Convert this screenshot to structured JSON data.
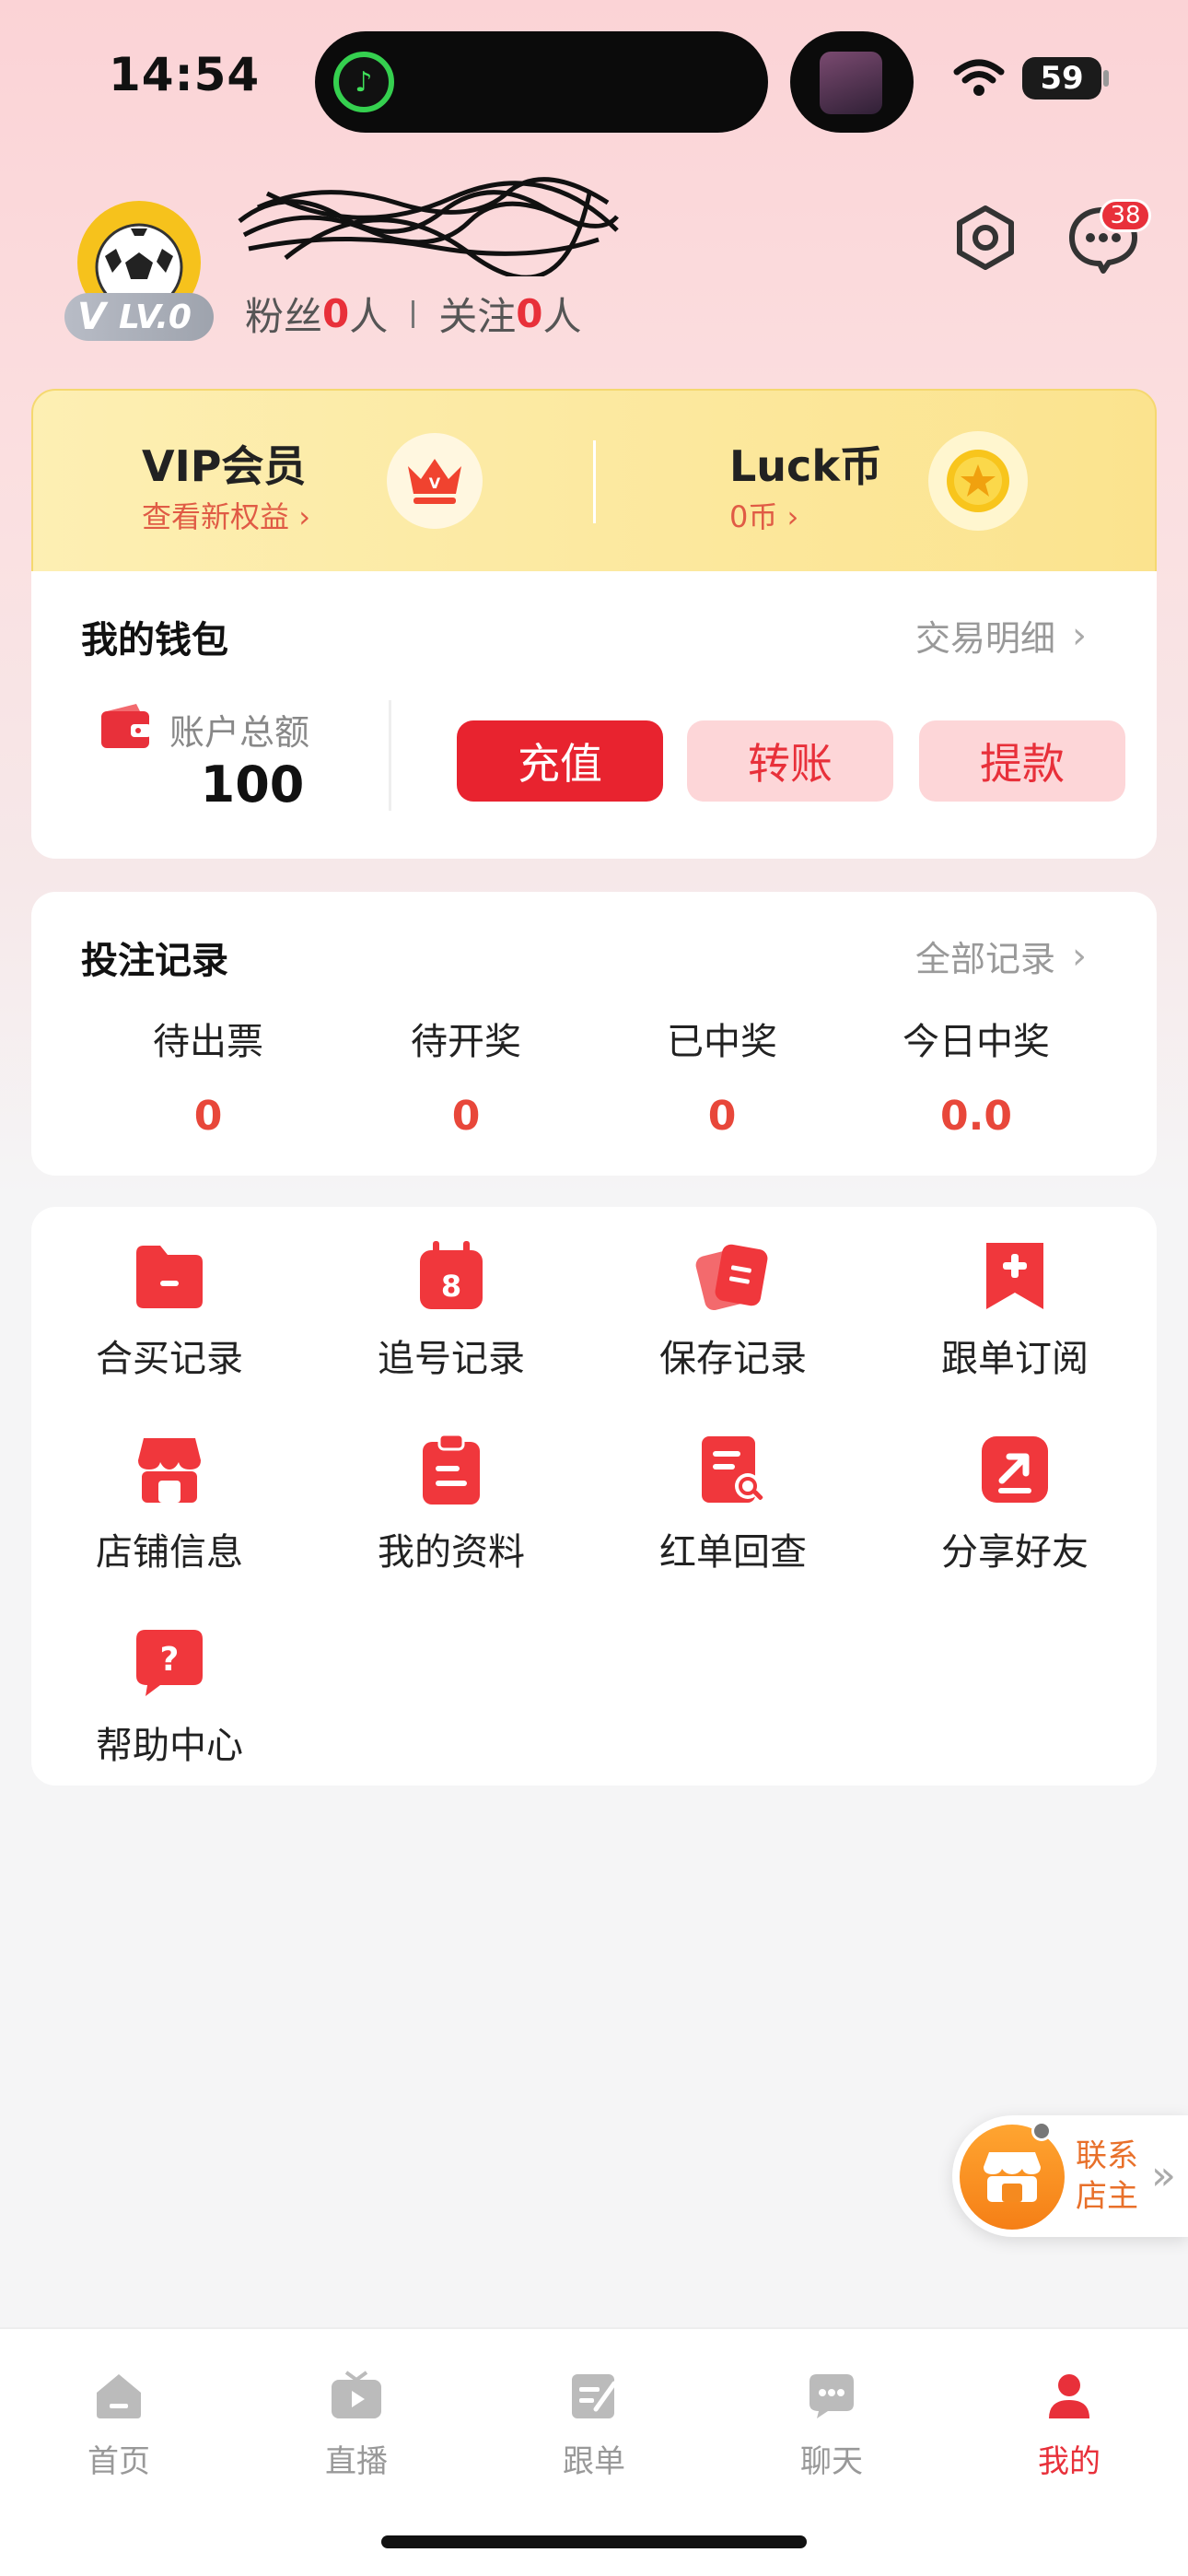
{
  "status_bar": {
    "time": "14:54",
    "battery": "59"
  },
  "profile": {
    "level": "LV.0",
    "level_v": "V",
    "fans_label": "粉丝",
    "fans_count": "0",
    "fans_unit": "人",
    "follow_label": "关注",
    "follow_count": "0",
    "follow_unit": "人",
    "message_badge": "38"
  },
  "vip": {
    "title": "VIP会员",
    "subtitle": "查看新权益",
    "luck_title": "Luck币",
    "luck_sub": "0币"
  },
  "wallet": {
    "title": "我的钱包",
    "link": "交易明细",
    "balance_label": "账户总额",
    "balance_value": "100",
    "buttons": [
      "充值",
      "转账",
      "提款"
    ]
  },
  "bets": {
    "title": "投注记录",
    "link": "全部记录",
    "stats": [
      {
        "label": "待出票",
        "value": "0"
      },
      {
        "label": "待开奖",
        "value": "0"
      },
      {
        "label": "已中奖",
        "value": "0"
      },
      {
        "label": "今日中奖",
        "value": "0.0"
      }
    ]
  },
  "grid": [
    {
      "label": "合买记录",
      "icon": "folder-icon"
    },
    {
      "label": "追号记录",
      "icon": "calendar-icon"
    },
    {
      "label": "保存记录",
      "icon": "cards-icon"
    },
    {
      "label": "跟单订阅",
      "icon": "bookmark-icon"
    },
    {
      "label": "店铺信息",
      "icon": "store-icon"
    },
    {
      "label": "我的资料",
      "icon": "clipboard-icon"
    },
    {
      "label": "红单回查",
      "icon": "document-search-icon"
    },
    {
      "label": "分享好友",
      "icon": "share-icon"
    },
    {
      "label": "帮助中心",
      "icon": "help-icon"
    }
  ],
  "contact": {
    "line1": "联系",
    "line2": "店主"
  },
  "tabs": [
    {
      "label": "首页",
      "icon": "home-icon"
    },
    {
      "label": "直播",
      "icon": "tv-icon"
    },
    {
      "label": "跟单",
      "icon": "note-icon"
    },
    {
      "label": "聊天",
      "icon": "chat-icon"
    },
    {
      "label": "我的",
      "icon": "user-icon"
    }
  ],
  "colors": {
    "accent": "#e8303a",
    "vip_bg": "#fbe38e",
    "contact": "#f57f16"
  }
}
